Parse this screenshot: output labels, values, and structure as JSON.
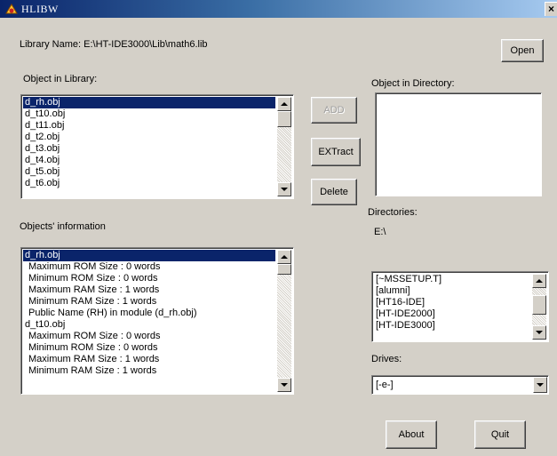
{
  "window": {
    "title": "HLIBW",
    "close_glyph": "×"
  },
  "library": {
    "label": "Library Name: E:\\HT-IDE3000\\Lib\\math6.lib"
  },
  "buttons": {
    "open": "Open",
    "add": "ADD",
    "extract": "EXTract",
    "delete": "Delete",
    "about": "About",
    "quit": "Quit"
  },
  "object_in_library": {
    "label": "Object in Library:",
    "items": [
      "d_rh.obj",
      "d_t10.obj",
      "d_t11.obj",
      "d_t2.obj",
      "d_t3.obj",
      "d_t4.obj",
      "d_t5.obj",
      "d_t6.obj"
    ],
    "selected": "d_rh.obj"
  },
  "object_in_directory": {
    "label": "Object in Directory:",
    "items": []
  },
  "objects_info": {
    "label": "Objects' information",
    "items": [
      "d_rh.obj",
      "Maximum ROM Size : 0 words",
      "Minimum ROM Size : 0 words",
      "Maximum RAM Size : 1 words",
      "Minimum RAM Size : 1 words",
      "Public Name (RH) in module (d_rh.obj)",
      "d_t10.obj",
      "Maximum ROM Size : 0 words",
      "Minimum ROM Size : 0 words",
      "Maximum RAM Size : 1 words",
      "Minimum RAM Size : 1 words"
    ],
    "selected": "d_rh.obj"
  },
  "directories": {
    "label": "Directories:",
    "current": "E:\\",
    "items": [
      "[~MSSETUP.T]",
      "[alumni]",
      "[HT16-IDE]",
      "[HT-IDE2000]",
      "[HT-IDE3000]"
    ]
  },
  "drives": {
    "label": "Drives:",
    "value": "[-e-]"
  },
  "colors": {
    "selection": "#0a246a",
    "face": "#d4d0c8",
    "title_start": "#0a246a"
  }
}
